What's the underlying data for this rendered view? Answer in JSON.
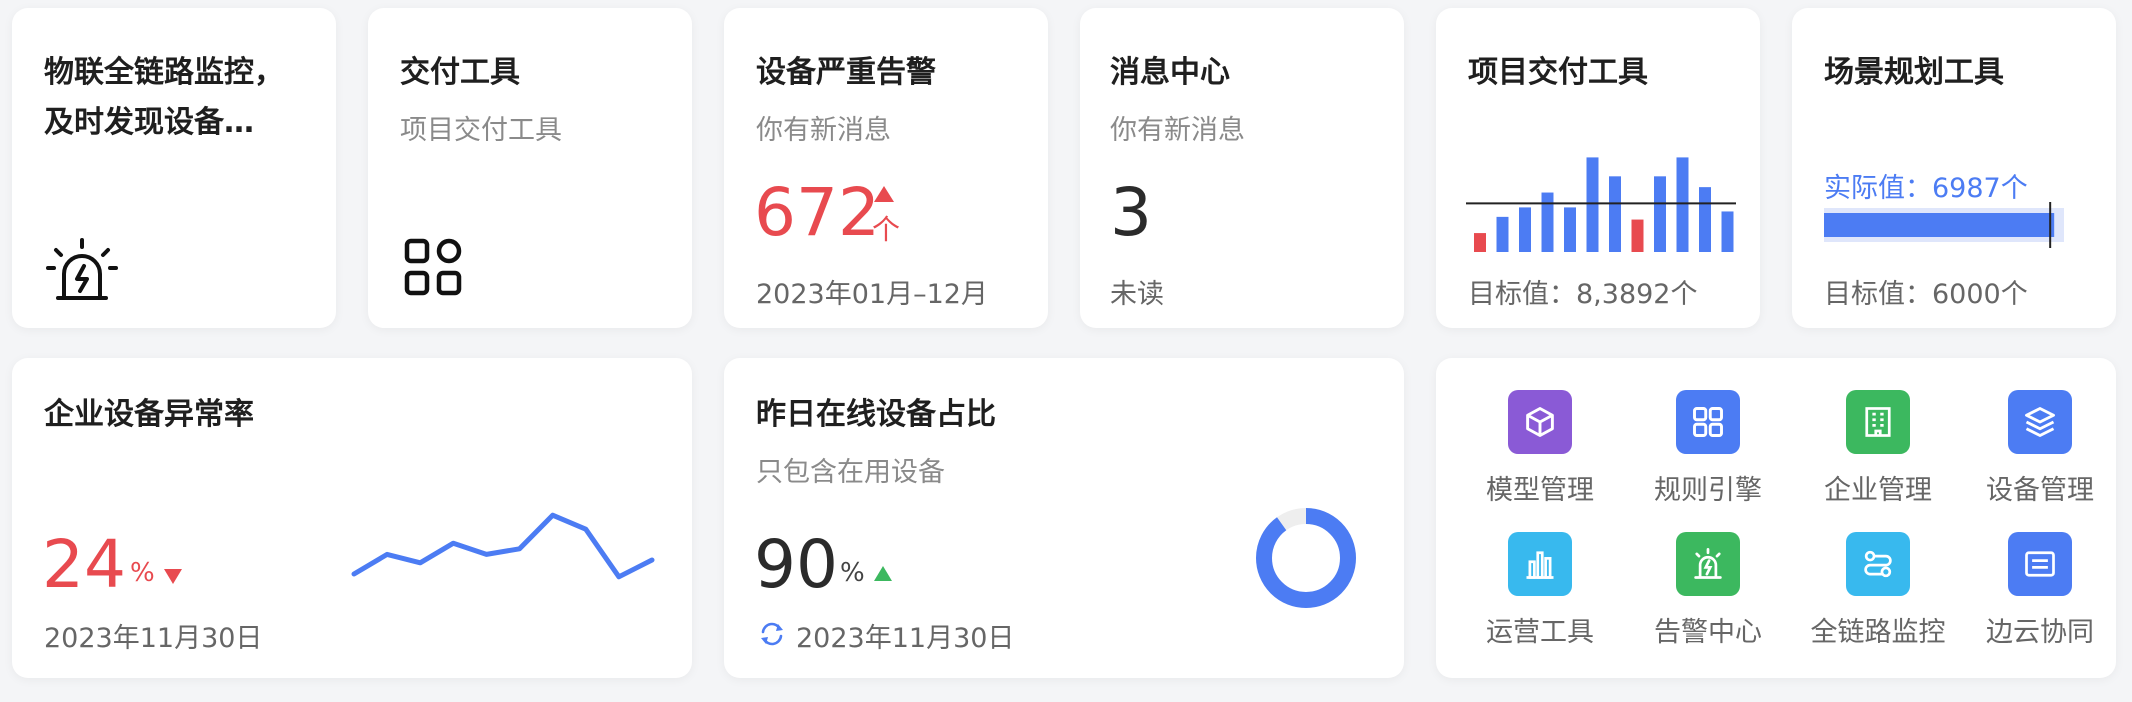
{
  "cards": {
    "monitor": {
      "title": "物联全链路监控，及时发现设备…",
      "icon": "alarm-icon"
    },
    "delivery": {
      "title": "交付工具",
      "subtitle": "项目交付工具",
      "icon": "apps-grid-icon"
    },
    "alarm": {
      "title": "设备严重告警",
      "subtitle": "你有新消息",
      "value": "672",
      "unit": "个",
      "range": "2023年01月–12月"
    },
    "messages": {
      "title": "消息中心",
      "subtitle": "你有新消息",
      "value": "3",
      "label": "未读"
    },
    "project_delivery": {
      "title": "项目交付工具",
      "target_label": "目标值：8,3892个"
    },
    "scene": {
      "title": "场景规划工具",
      "actual_label": "实际值：6987个",
      "target_label": "目标值：6000个"
    },
    "abnormal": {
      "title": "企业设备异常率",
      "value": "24",
      "unit": "%",
      "date": "2023年11月30日"
    },
    "online": {
      "title": "昨日在线设备占比",
      "subtitle": "只包含在用设备",
      "value": "90",
      "unit": "%",
      "date": "2023年11月30日"
    }
  },
  "apps": [
    {
      "label": "模型管理",
      "icon": "cube-icon",
      "color": "#8a5ad6"
    },
    {
      "label": "规则引擎",
      "icon": "grid-icon",
      "color": "#4c7cf3"
    },
    {
      "label": "企业管理",
      "icon": "building-icon",
      "color": "#3cb85f"
    },
    {
      "label": "设备管理",
      "icon": "layers-icon",
      "color": "#4c7cf3"
    },
    {
      "label": "运营工具",
      "icon": "bar-chart-icon",
      "color": "#38b9ee"
    },
    {
      "label": "告警中心",
      "icon": "alarm-light-icon",
      "color": "#3cb85f"
    },
    {
      "label": "全链路监控",
      "icon": "link-icon",
      "color": "#38b9ee"
    },
    {
      "label": "边云协同",
      "icon": "window-icon",
      "color": "#4c7cf3"
    }
  ],
  "chart_data": [
    {
      "type": "bar",
      "values": [
        14,
        26,
        33,
        44,
        33,
        70,
        56,
        24,
        56,
        70,
        48,
        30
      ],
      "highlight": [
        1,
        0,
        0,
        0,
        0,
        0,
        0,
        1,
        0,
        0,
        0,
        0
      ],
      "target": 36,
      "colors": {
        "normal": "#4c7cf3",
        "low": "#e84a4f"
      }
    },
    {
      "type": "progress",
      "value": 6987,
      "target": 6000,
      "max": 7100
    },
    {
      "type": "line",
      "values": [
        20,
        34,
        28,
        42,
        34,
        38,
        62,
        52,
        18,
        30
      ],
      "color": "#4c7cf3"
    },
    {
      "type": "pie",
      "values": [
        90,
        10
      ],
      "colors": [
        "#4c7cf3",
        "#eeeeee"
      ]
    }
  ]
}
